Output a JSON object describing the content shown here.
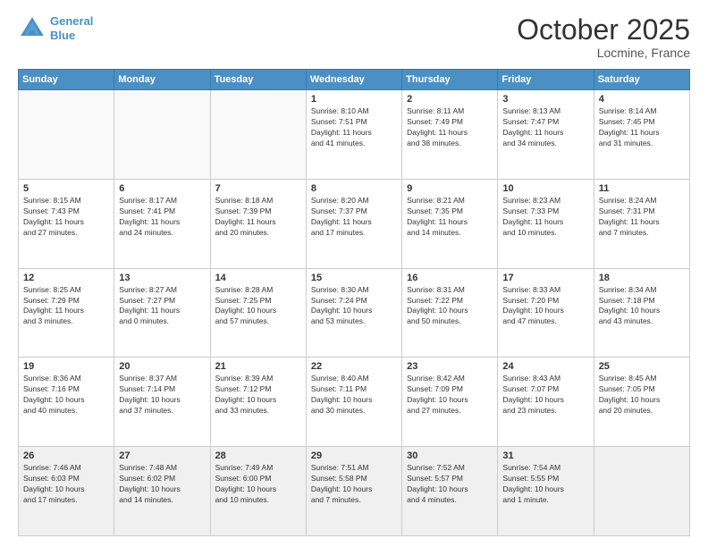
{
  "header": {
    "logo_line1": "General",
    "logo_line2": "Blue",
    "month": "October 2025",
    "location": "Locmine, France"
  },
  "weekdays": [
    "Sunday",
    "Monday",
    "Tuesday",
    "Wednesday",
    "Thursday",
    "Friday",
    "Saturday"
  ],
  "weeks": [
    [
      {
        "day": "",
        "info": ""
      },
      {
        "day": "",
        "info": ""
      },
      {
        "day": "",
        "info": ""
      },
      {
        "day": "1",
        "info": "Sunrise: 8:10 AM\nSunset: 7:51 PM\nDaylight: 11 hours\nand 41 minutes."
      },
      {
        "day": "2",
        "info": "Sunrise: 8:11 AM\nSunset: 7:49 PM\nDaylight: 11 hours\nand 38 minutes."
      },
      {
        "day": "3",
        "info": "Sunrise: 8:13 AM\nSunset: 7:47 PM\nDaylight: 11 hours\nand 34 minutes."
      },
      {
        "day": "4",
        "info": "Sunrise: 8:14 AM\nSunset: 7:45 PM\nDaylight: 11 hours\nand 31 minutes."
      }
    ],
    [
      {
        "day": "5",
        "info": "Sunrise: 8:15 AM\nSunset: 7:43 PM\nDaylight: 11 hours\nand 27 minutes."
      },
      {
        "day": "6",
        "info": "Sunrise: 8:17 AM\nSunset: 7:41 PM\nDaylight: 11 hours\nand 24 minutes."
      },
      {
        "day": "7",
        "info": "Sunrise: 8:18 AM\nSunset: 7:39 PM\nDaylight: 11 hours\nand 20 minutes."
      },
      {
        "day": "8",
        "info": "Sunrise: 8:20 AM\nSunset: 7:37 PM\nDaylight: 11 hours\nand 17 minutes."
      },
      {
        "day": "9",
        "info": "Sunrise: 8:21 AM\nSunset: 7:35 PM\nDaylight: 11 hours\nand 14 minutes."
      },
      {
        "day": "10",
        "info": "Sunrise: 8:23 AM\nSunset: 7:33 PM\nDaylight: 11 hours\nand 10 minutes."
      },
      {
        "day": "11",
        "info": "Sunrise: 8:24 AM\nSunset: 7:31 PM\nDaylight: 11 hours\nand 7 minutes."
      }
    ],
    [
      {
        "day": "12",
        "info": "Sunrise: 8:25 AM\nSunset: 7:29 PM\nDaylight: 11 hours\nand 3 minutes."
      },
      {
        "day": "13",
        "info": "Sunrise: 8:27 AM\nSunset: 7:27 PM\nDaylight: 11 hours\nand 0 minutes."
      },
      {
        "day": "14",
        "info": "Sunrise: 8:28 AM\nSunset: 7:25 PM\nDaylight: 10 hours\nand 57 minutes."
      },
      {
        "day": "15",
        "info": "Sunrise: 8:30 AM\nSunset: 7:24 PM\nDaylight: 10 hours\nand 53 minutes."
      },
      {
        "day": "16",
        "info": "Sunrise: 8:31 AM\nSunset: 7:22 PM\nDaylight: 10 hours\nand 50 minutes."
      },
      {
        "day": "17",
        "info": "Sunrise: 8:33 AM\nSunset: 7:20 PM\nDaylight: 10 hours\nand 47 minutes."
      },
      {
        "day": "18",
        "info": "Sunrise: 8:34 AM\nSunset: 7:18 PM\nDaylight: 10 hours\nand 43 minutes."
      }
    ],
    [
      {
        "day": "19",
        "info": "Sunrise: 8:36 AM\nSunset: 7:16 PM\nDaylight: 10 hours\nand 40 minutes."
      },
      {
        "day": "20",
        "info": "Sunrise: 8:37 AM\nSunset: 7:14 PM\nDaylight: 10 hours\nand 37 minutes."
      },
      {
        "day": "21",
        "info": "Sunrise: 8:39 AM\nSunset: 7:12 PM\nDaylight: 10 hours\nand 33 minutes."
      },
      {
        "day": "22",
        "info": "Sunrise: 8:40 AM\nSunset: 7:11 PM\nDaylight: 10 hours\nand 30 minutes."
      },
      {
        "day": "23",
        "info": "Sunrise: 8:42 AM\nSunset: 7:09 PM\nDaylight: 10 hours\nand 27 minutes."
      },
      {
        "day": "24",
        "info": "Sunrise: 8:43 AM\nSunset: 7:07 PM\nDaylight: 10 hours\nand 23 minutes."
      },
      {
        "day": "25",
        "info": "Sunrise: 8:45 AM\nSunset: 7:05 PM\nDaylight: 10 hours\nand 20 minutes."
      }
    ],
    [
      {
        "day": "26",
        "info": "Sunrise: 7:46 AM\nSunset: 6:03 PM\nDaylight: 10 hours\nand 17 minutes."
      },
      {
        "day": "27",
        "info": "Sunrise: 7:48 AM\nSunset: 6:02 PM\nDaylight: 10 hours\nand 14 minutes."
      },
      {
        "day": "28",
        "info": "Sunrise: 7:49 AM\nSunset: 6:00 PM\nDaylight: 10 hours\nand 10 minutes."
      },
      {
        "day": "29",
        "info": "Sunrise: 7:51 AM\nSunset: 5:58 PM\nDaylight: 10 hours\nand 7 minutes."
      },
      {
        "day": "30",
        "info": "Sunrise: 7:52 AM\nSunset: 5:57 PM\nDaylight: 10 hours\nand 4 minutes."
      },
      {
        "day": "31",
        "info": "Sunrise: 7:54 AM\nSunset: 5:55 PM\nDaylight: 10 hours\nand 1 minute."
      },
      {
        "day": "",
        "info": ""
      }
    ]
  ]
}
